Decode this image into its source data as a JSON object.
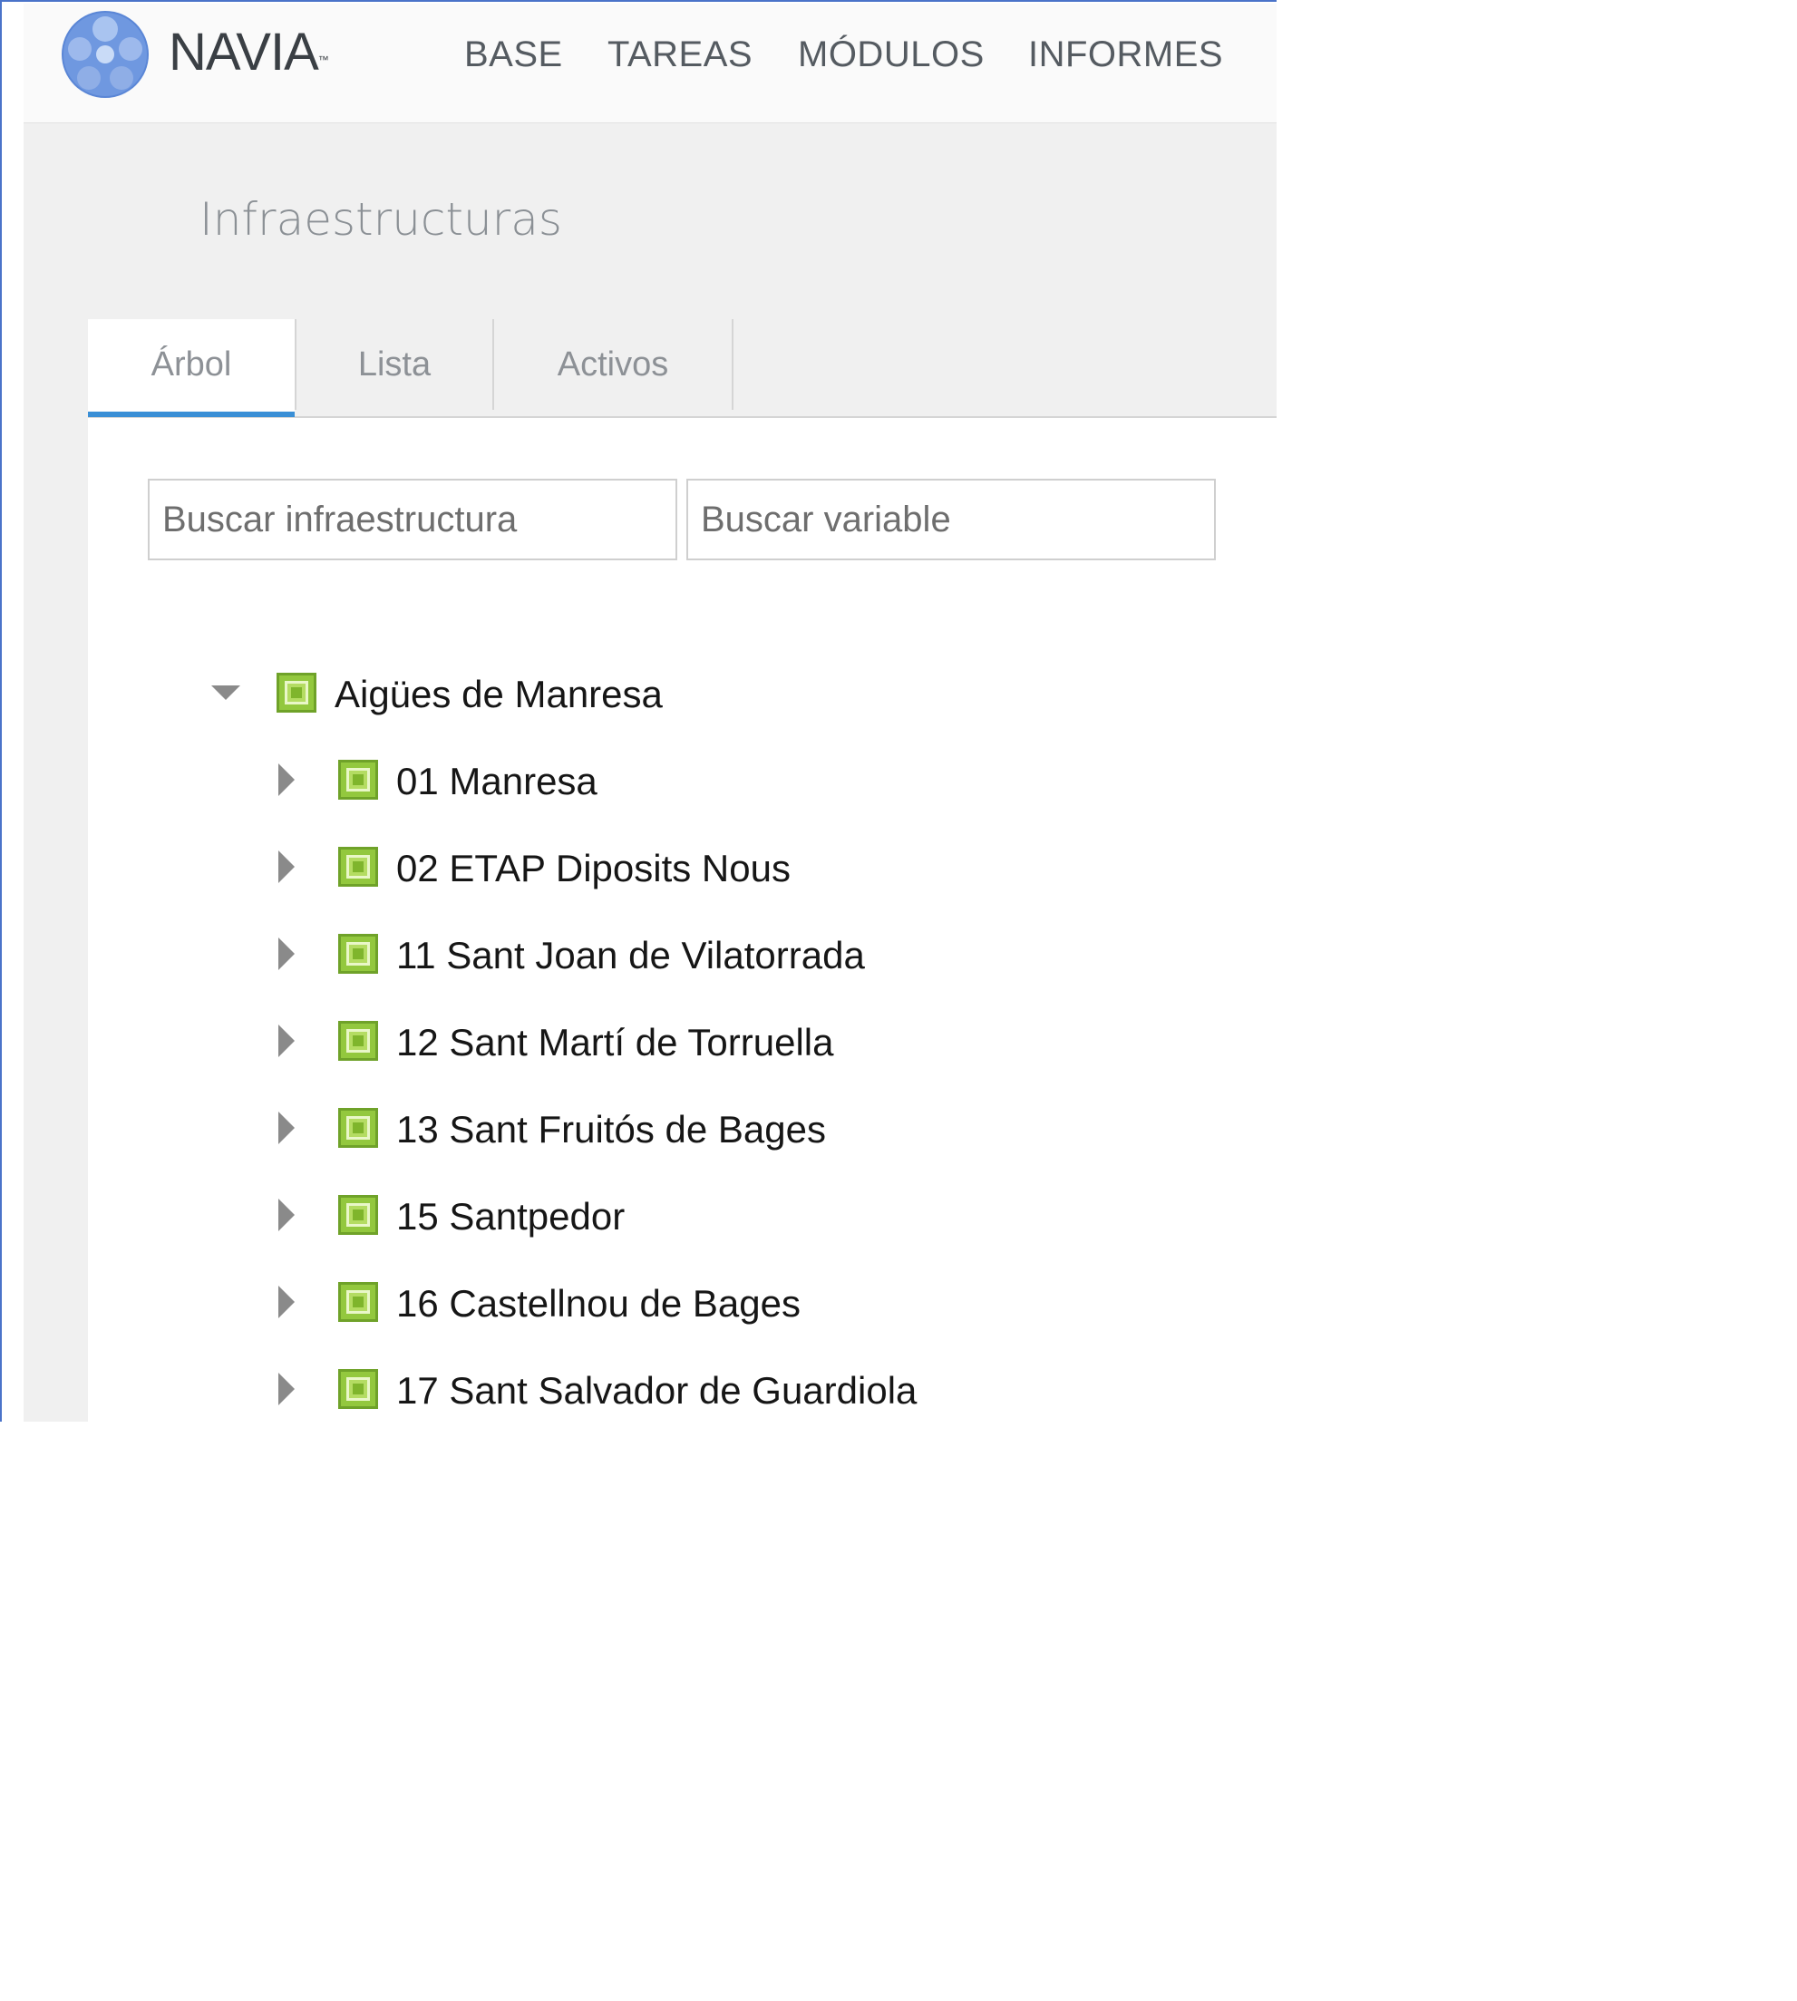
{
  "brand": {
    "name": "NAVIA",
    "tm": "™"
  },
  "nav": {
    "items": [
      {
        "label": "BASE"
      },
      {
        "label": "TAREAS"
      },
      {
        "label": "MÓDULOS"
      },
      {
        "label": "INFORMES"
      }
    ]
  },
  "page": {
    "title": "Infraestructuras"
  },
  "tabs": [
    {
      "label": "Árbol",
      "active": true
    },
    {
      "label": "Lista",
      "active": false
    },
    {
      "label": "Activos",
      "active": false
    }
  ],
  "search": {
    "infra_placeholder": "Buscar infraestructura",
    "variable_placeholder": "Buscar variable"
  },
  "tree": {
    "root": {
      "label": "Aigües de Manresa",
      "expanded": true,
      "icon": "infrastructure-icon"
    },
    "children": [
      {
        "label": "01 Manresa"
      },
      {
        "label": "02 ETAP Diposits Nous"
      },
      {
        "label": "11 Sant Joan de Vilatorrada"
      },
      {
        "label": "12 Sant Martí de Torruella"
      },
      {
        "label": "13 Sant Fruitós de Bages"
      },
      {
        "label": "15 Santpedor"
      },
      {
        "label": "16 Castellnou de Bages"
      },
      {
        "label": "17 Sant Salvador de Guardiola"
      }
    ]
  },
  "colors": {
    "accent": "#3a8fd6",
    "node_green": "#93c83e",
    "frame_border": "#4a73c9"
  }
}
